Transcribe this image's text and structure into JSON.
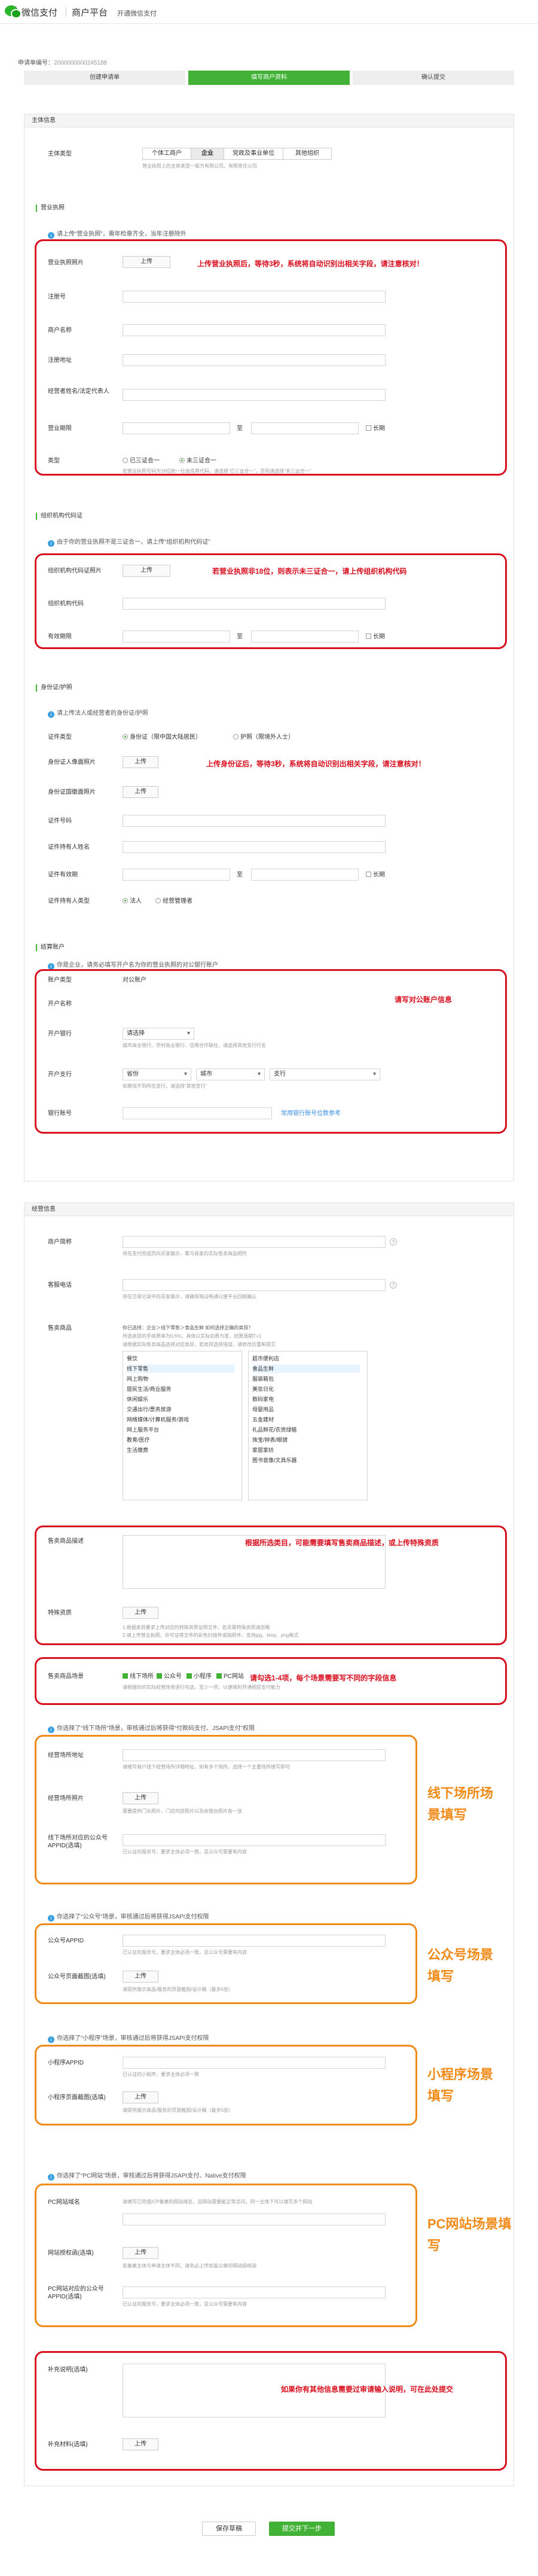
{
  "brand": {
    "name": "微信支付",
    "sub": "商户平台",
    "tagline": "开通微信支付"
  },
  "application_no": {
    "label": "申请单编号：",
    "value": "2000000000245188"
  },
  "steps": [
    "创建申请单",
    "填写商户资料",
    "确认提交"
  ],
  "subject": {
    "title": "主体信息",
    "type_label": "主体类型",
    "types": [
      "个体工商户",
      "企业",
      "党政及事业单位",
      "其他组织"
    ],
    "type_hint": "营业执照上的主体类型一般为有限公司、有限责任公司",
    "license_section": "营业执照",
    "license_tip": "请上传“营业执照”，需年检章齐全，当年注册除外",
    "license_photo": "营业执照照片",
    "upload": "上传",
    "license_annotation": "上传营业执照后，等待3秒，系统将自动识别出相关字段，请注意核对！",
    "reg_no": "注册号",
    "merchant_name": "商户名称",
    "reg_address": "注册地址",
    "legal_person": "经营者姓名/法定代表人",
    "validity": "营业期限",
    "to": "至",
    "longterm": "长期",
    "kind_label": "类型",
    "kind_opts": [
      "已三证合一",
      "未三证合一"
    ],
    "kind_hint": "若营业执照号码为18位统一社会信用代码，请选择“已三证合一”，否则请选择“未三证合一”"
  },
  "org": {
    "section": "组织机构代码证",
    "tip": "由于你的营业执照不是三证合一，请上传“组织机构代码证”",
    "photo": "组织机构代码证照片",
    "annotation": "若营业执照非18位，则表示未三证合一，请上传组织机构代码",
    "code": "组织机构代码",
    "validity": "有效期限"
  },
  "idcard": {
    "section": "身份证/护照",
    "tip": "请上传法人或经营者的身份证/护照",
    "type_label": "证件类型",
    "type_opts": [
      "身份证（限中国大陆居民）",
      "护照（限境外人士）"
    ],
    "front": "身份证人像面照片",
    "back": "身份证国徽面照片",
    "annotation": "上传身份证后，等待3秒，系统将自动识别出相关字段，请注意核对！",
    "number": "证件号码",
    "holder": "证件持有人姓名",
    "validity": "证件有效期",
    "holder_type": "证件持有人类型",
    "holder_opts": [
      "法人",
      "经营管理者"
    ]
  },
  "bank": {
    "section": "结算账户",
    "tip": "你是企业，请务必填写开户名为你的营业执照的对公银行账户",
    "account_type": "账户类型",
    "account_type_value": "对公账户",
    "account_name": "开户名称",
    "bank_label": "开户银行",
    "bank_placeholder": "请选择",
    "bank_hint": "城市商业银行、农村商业银行、信用合作联社，请选择其他支行行名",
    "branch_label": "开户支行",
    "province": "省份",
    "city": "城市",
    "branch": "支行",
    "branch_hint": "如果找不到所在支行，请选择“其他支行”",
    "account_no": "银行账号",
    "bank_list_link": "常用银行账号位数参考",
    "annotation": "请写对公账户信息"
  },
  "biz": {
    "title": "经营信息",
    "short_name": "商户简称",
    "short_hint": "将在支付完成页向买家展示，需与商家的实际售卖商品相符",
    "phone": "客服电话",
    "phone_hint": "将在交易记录中向买家展示，请确保电话畅通以便平台回拨确认",
    "category": "售卖商品",
    "category_hint": "你已选择：企业＞线下零售＞食品生鲜 如何选择正确的类目？",
    "category_hint2": "所选类目的手续费率为0.6%，具体以实际扣费为准，结算周期T+1",
    "category_hint3": "请根据实际售卖商品选择对应类目，若类目选择错误，请修改后重新提交",
    "cat_left": [
      "餐饮",
      "线下零售",
      "网上购物",
      "居民生活/商业服务",
      "休闲娱乐",
      "交通出行/票务旅游",
      "网络媒体/计算机服务/游戏",
      "网上服务平台",
      "教育/医疗",
      "生活缴费"
    ],
    "cat_right": [
      "超市便利店",
      "食品生鲜",
      "服装箱包",
      "美妆日化",
      "数码家电",
      "母婴用品",
      "五金建材",
      "礼品鲜花/农资绿植",
      "珠宝/钟表/眼镜",
      "家居家纺",
      "图书音像/文具乐器"
    ],
    "desc": "售卖商品描述",
    "desc_annotation": "根据所选类目，可能需要填写售卖商品描述，或上传特殊资质",
    "qual": "特殊资质",
    "qual_hint": "1.根据类目要求上传对应的特殊资质证明文件，若无需特殊资质请忽略",
    "qual_hint2": "2.请上传营业执照、许可证等文件的彩色扫描件或拍照件，支持jpg、bmp、png格式",
    "scene_label": "售卖商品场景",
    "scenes": [
      "线下场所",
      "公众号",
      "小程序",
      "PC网站"
    ],
    "scene_annotation": "请勾选1-4项，每个场景需要写不同的字段信息",
    "scene_hint": "请根据你的实际经营场景进行勾选，至少一项，以便顺利开通相应支付能力"
  },
  "offline": {
    "tip": "你选择了“线下场所”场景，审核通过后将获得“付款码支付、JSAPI支付”权限",
    "addr": "经营场所地址",
    "addr_hint": "请填写商户线下经营场所详细地址，如有多个场所，选择一个主要场所填写即可",
    "photo": "经营场所照片",
    "photo_hint": "需要提供门头照片，门店内部照片以及收银台照片各一张",
    "appid": "线下场所对应的公众号APPID(选填)",
    "appid_hint": "已认证的服务号，要求主体必须一致，且公众号需要有内容",
    "side": "线下场所场景填写"
  },
  "mp": {
    "tip": "你选择了“公众号”场景，审核通过后将获得JSAPI支付权限",
    "appid": "公众号APPID",
    "appid_hint": "已认证的服务号，要求主体必须一致，且公众号需要有内容",
    "shot": "公众号页面截图(选填)",
    "shot_hint": "请提供展示商品/服务的页面截图/设计稿（最多5张）",
    "side": "公众号场景填写"
  },
  "mini": {
    "tip": "你选择了“小程序”场景，审核通过后将获得JSAPI支付权限",
    "appid": "小程序APPID",
    "appid_hint": "已认证的小程序，要求主体必须一致",
    "shot": "小程序页面截图(选填)",
    "shot_hint": "请提供展示商品/服务的页面截图/设计稿（最多5张）",
    "side": "小程序场景填写"
  },
  "pc": {
    "tip": "你选择了“PC网站”场景，审核通过后将获得JSAPI支付、Native支付权限",
    "url": "PC网站域名",
    "url_hint": "请填写已完成ICP备案的网站域名，且网站需要能正常访问，同一主体下可以填写多个网站",
    "auth": "网站授权函(选填)",
    "auth_hint": "若备案主体与申请主体不同，请务必上传加盖公章的网站授权函",
    "appid": "PC网站对应的公众号APPID(选填)",
    "appid_hint": "已认证的服务号，要求主体必须一致，且公众号需要有内容",
    "side": "PC网站场景填写"
  },
  "extra": {
    "desc": "补充说明(选填)",
    "material": "补充材料(选填)",
    "annotation": "如果你有其他信息需要过审请输入说明，可在此处提交"
  },
  "footer": {
    "save": "保存草稿",
    "next": "提交并下一步"
  }
}
